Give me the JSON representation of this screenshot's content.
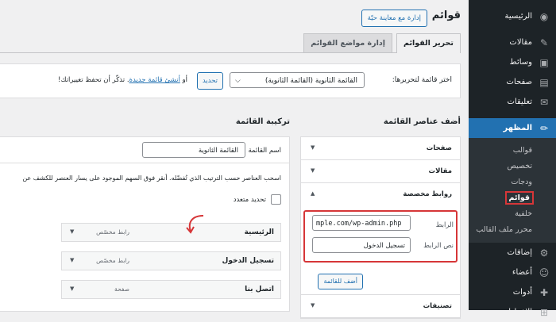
{
  "sidebar": {
    "items": [
      {
        "label": "الرئيسية",
        "icon": "dashboard-icon",
        "glyph": "◉"
      },
      {
        "label": "مقالات",
        "icon": "pin-icon",
        "glyph": "✎"
      },
      {
        "label": "وسائط",
        "icon": "media-icon",
        "glyph": "▣"
      },
      {
        "label": "صفحات",
        "icon": "pages-icon",
        "glyph": "▤"
      },
      {
        "label": "تعليقات",
        "icon": "comments-icon",
        "glyph": "✉"
      },
      {
        "label": "المظهر",
        "icon": "brush-icon",
        "glyph": "✏"
      }
    ],
    "submenu": [
      "قوالب",
      "تخصيص",
      "ودجات",
      "قوائم",
      "خلفية",
      "محرر ملف القالب"
    ],
    "items_after": [
      {
        "label": "إضافات",
        "icon": "plugins-icon",
        "glyph": "⚙"
      },
      {
        "label": "أعضاء",
        "icon": "users-icon",
        "glyph": "☺"
      },
      {
        "label": "أدوات",
        "icon": "tools-icon",
        "glyph": "✚"
      },
      {
        "label": "الإعدادات",
        "icon": "settings-icon",
        "glyph": "⊞"
      }
    ]
  },
  "header": {
    "title": "قوائم",
    "manage_live_button": "إدارة مع معاينة حيّة"
  },
  "tabs": [
    "تحرير القوائم",
    "إدارة مواضع القوائم"
  ],
  "select_bar": {
    "label": "اختر قائمة لتحريرها:",
    "selected": "القائمة الثانوية (القائمة الثانوية)",
    "update_button": "تحديد",
    "hint_prefix": "أو",
    "hint_link": "أنشئ قائمة جديدة",
    "hint_suffix": ". تذكّر أن تحفظ تغييراتك!"
  },
  "add_items": {
    "heading": "أضف عناصر القائمة",
    "sections": [
      "صفحات",
      "مقالات",
      "روابط مخصصة",
      "تصنيفات"
    ],
    "url_label": "الرابط",
    "url_value": "mple.com/wp-admin.php",
    "link_text_label": "نص الرابط",
    "link_text_value": "تسجيل الدخول",
    "add_button": "أضف للقائمة"
  },
  "structure": {
    "heading": "تركيبة القائمة",
    "name_label": "اسم القائمة",
    "name_value": "القائمة الثانوية",
    "drag_hint": "اسحب العناصر حسب الترتيب الذي تُفضّله. أنقر فوق السهم الموجود على يسار العنصر للكشف عن",
    "bulk_select": "تحديد متعدد",
    "entries": [
      {
        "title": "الرئيسية",
        "type": "رابط مخصّص"
      },
      {
        "title": "تسجيل الدخول",
        "type": "رابط مخصّص"
      },
      {
        "title": "اتصل بنا",
        "type": "صفحة"
      }
    ]
  },
  "colors": {
    "sidebar_bg": "#1d2327",
    "accent": "#2271b1",
    "highlight": "#d63638"
  }
}
